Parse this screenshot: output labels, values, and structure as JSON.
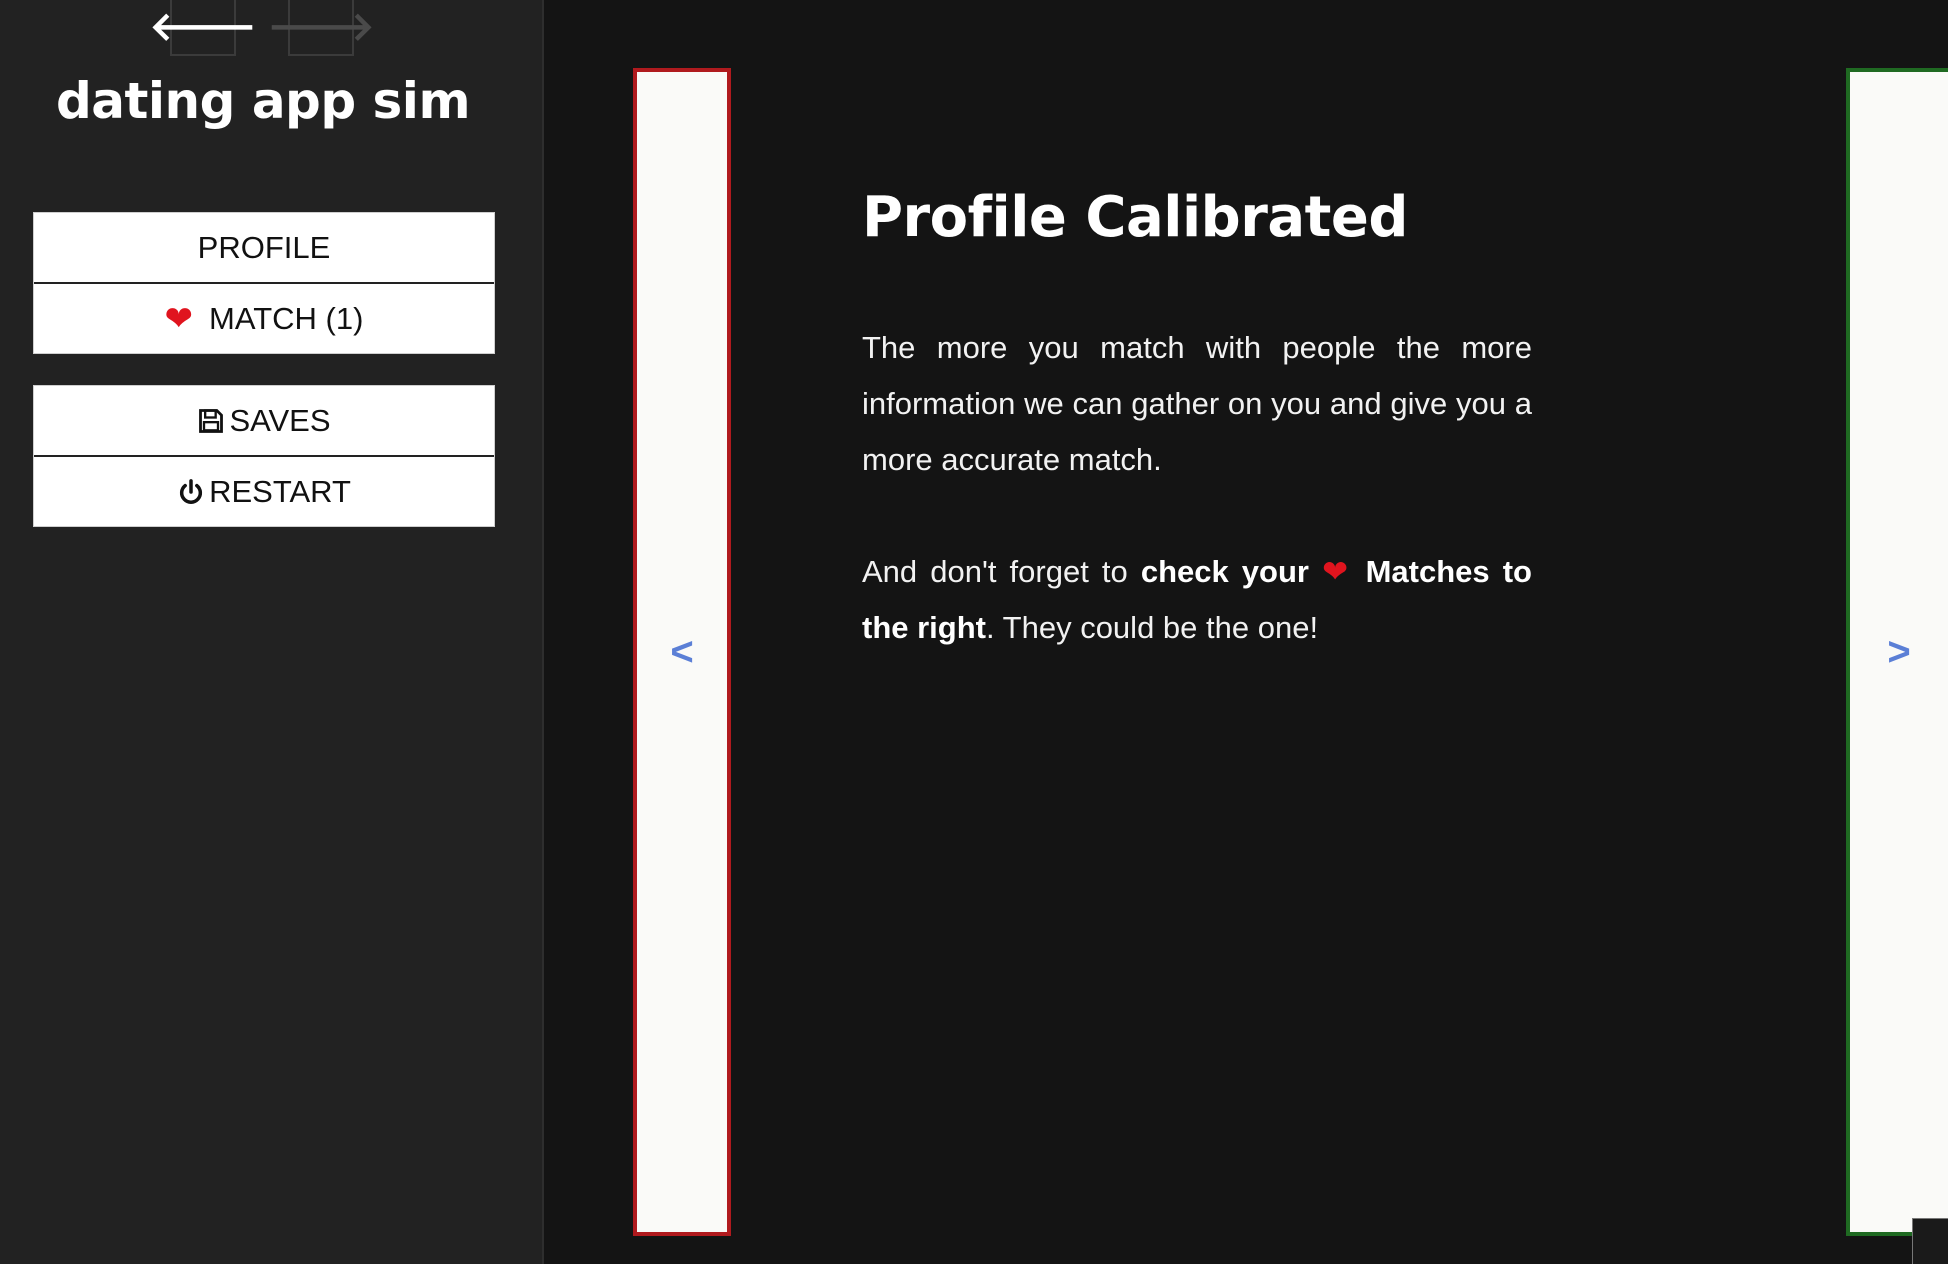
{
  "sidebar": {
    "nav": {
      "back_icon": "arrow-left-icon",
      "forward_icon": "arrow-right-icon"
    },
    "title": "dating app sim",
    "menu": {
      "profile": "PROFILE",
      "match": "MATCH (1)",
      "saves": "SAVES",
      "restart": "RESTART"
    }
  },
  "passage": {
    "title": "Profile Calibrated",
    "p1": "The more you match with people the more information we can gather on you and give you a more accurate match.",
    "p2_before": "And don't forget to ",
    "p2_bold1": "check your",
    "p2_bold2": "Matches to the right",
    "p2_after": ". They could be the one!"
  },
  "swipe": {
    "left_label": "<",
    "right_label": ">"
  },
  "colors": {
    "background": "#141414",
    "sidebar": "#222222",
    "heart": "#e0141e",
    "swipe_left_border": "#b01a1e",
    "swipe_right_border": "#1f6a22",
    "arrow_blue": "#5b7fd6"
  }
}
